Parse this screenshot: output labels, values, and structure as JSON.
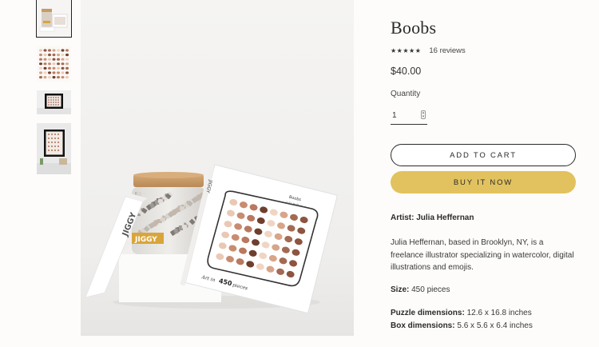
{
  "product": {
    "title": "Boobs",
    "stars": "★★★★★",
    "reviews": "16 reviews",
    "price": "$40.00",
    "quantity_label": "Quantity",
    "quantity_value": "1",
    "add_to_cart": "ADD TO CART",
    "buy_now": "BUY IT NOW",
    "artist_label": "Artist:",
    "artist_name": "Julia Heffernan",
    "description": "Julia Heffernan, based in Brooklyn, NY, is a freelance illustrator specializing in watercolor, digital illustrations and emojis.",
    "size_label": "Size:",
    "size_value": "450 pieces",
    "puzzle_dim_label": "Puzzle dimensions:",
    "puzzle_dim_value": "12.6 x 16.8 inches",
    "box_dim_label": "Box dimensions:",
    "box_dim_value": "5.6 x 5.6 x 6.4 inches"
  },
  "image_text": {
    "brand": "JIGGY",
    "box_title": "Boobs",
    "box_artist": "Julia Heffernan",
    "box_pieces_prefix": "Art in",
    "box_pieces_number": "450",
    "box_pieces_suffix": "pieces"
  },
  "colors": {
    "buy_button": "#e2c25e",
    "text": "#2b2b2b",
    "background": "#fdfcfa"
  }
}
